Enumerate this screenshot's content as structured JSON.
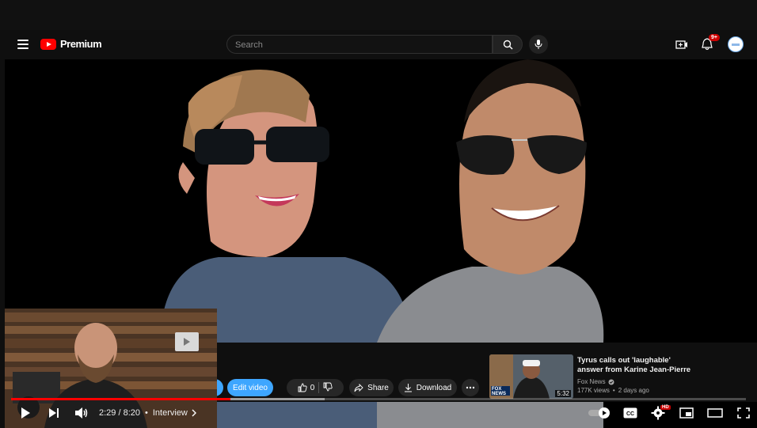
{
  "masthead": {
    "logo_text": "Premium",
    "search_placeholder": "Search",
    "notification_badge": "9+"
  },
  "actions": {
    "edit_video": "Edit video",
    "like_count": "0",
    "share": "Share",
    "download": "Download"
  },
  "recommended": {
    "title_line1": "Tyrus calls out 'laughable'",
    "title_line2": "answer from Karine Jean-Pierre",
    "channel": "Fox News",
    "views": "177K views",
    "age": "2 days ago",
    "duration": "5:32",
    "thumb_label": "FOX NEWS"
  },
  "player": {
    "current_time": "2:29",
    "duration": "8:20",
    "time_display": "2:29 / 8:20",
    "chapter": "Interview",
    "progress_fraction": 0.298,
    "settings_badge": "HD"
  },
  "colors": {
    "brand": "#ff0000",
    "accent_blue": "#3ea6ff",
    "bg": "#0f0f0f"
  }
}
